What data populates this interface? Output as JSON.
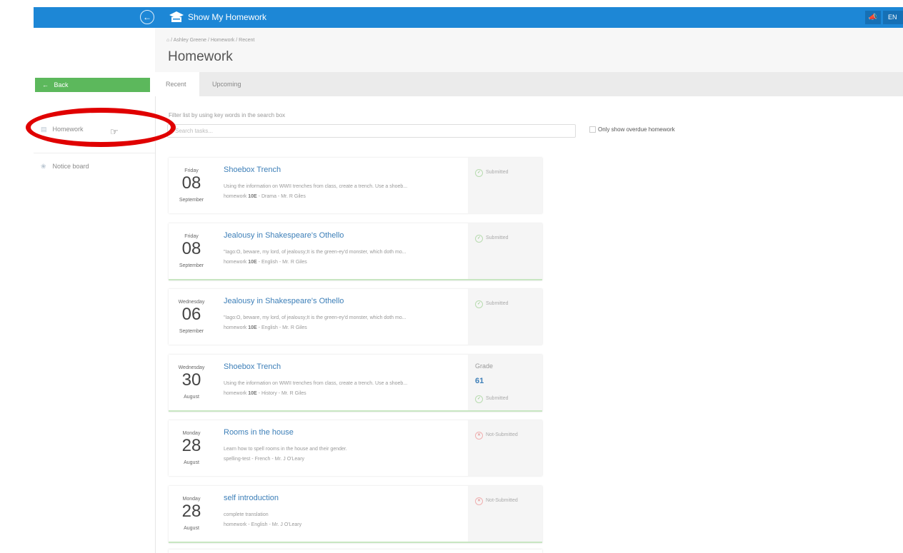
{
  "app": {
    "brand": "Show My Homework",
    "language": "EN"
  },
  "sidebar": {
    "back_label": "Back",
    "items": [
      {
        "label": "Homework",
        "icon": "list-icon"
      },
      {
        "label": "Notice board",
        "icon": "pin-icon"
      }
    ]
  },
  "header": {
    "breadcrumb": [
      "Ashley Greene",
      "Homework",
      "Recent"
    ],
    "title": "Homework"
  },
  "tabs": [
    {
      "label": "Recent",
      "active": true
    },
    {
      "label": "Upcoming",
      "active": false
    }
  ],
  "filter": {
    "help": "Filter list by using key words in the search box",
    "placeholder": "Search tasks...",
    "overdue_label": "Only show overdue homework"
  },
  "tasks": [
    {
      "dow": "Friday",
      "day": "08",
      "month": "September",
      "title": "Shoebox Trench",
      "desc": "Using the information on WWII trenches from class, create a trench. Use a shoeb...",
      "type": "homework",
      "class": "10E",
      "subject": "Drama",
      "teacher": "Mr. R Giles",
      "status": "Submitted"
    },
    {
      "dow": "Friday",
      "day": "08",
      "month": "September",
      "title": "Jealousy in Shakespeare's Othello",
      "desc": "\"Iago:O, beware, my lord, of jealousy;It is the green-ey'd monster, which doth mo...",
      "type": "homework",
      "class": "10E",
      "subject": "English",
      "teacher": "Mr. R Giles",
      "status": "Submitted"
    },
    {
      "dow": "Wednesday",
      "day": "06",
      "month": "September",
      "title": "Jealousy in Shakespeare's Othello",
      "desc": "\"Iago:O, beware, my lord, of jealousy;It is the green-ey'd monster, which doth mo...",
      "type": "homework",
      "class": "10E",
      "subject": "English",
      "teacher": "Mr. R Giles",
      "status": "Submitted"
    },
    {
      "dow": "Wednesday",
      "day": "30",
      "month": "August",
      "title": "Shoebox Trench",
      "desc": "Using the information on WWII trenches from class, create a trench. Use a shoeb...",
      "type": "homework",
      "class": "10E",
      "subject": "History",
      "teacher": "Mr. R Giles",
      "grade_label": "Grade",
      "grade": "61",
      "status": "Submitted"
    },
    {
      "dow": "Monday",
      "day": "28",
      "month": "August",
      "title": "Rooms in the house",
      "desc": "Learn how to spell rooms in the house and their gender.",
      "type": "spelling-test",
      "class": "",
      "subject": "French",
      "teacher": "Mr. J O'Leary",
      "status": "Not-Submitted"
    },
    {
      "dow": "Monday",
      "day": "28",
      "month": "August",
      "title": "self introduction",
      "desc": "complete translation",
      "type": "homework",
      "class": "",
      "subject": "English",
      "teacher": "Mr. J O'Leary",
      "status": "Not-Submitted"
    }
  ],
  "colors": {
    "topbar": "#1d87d6",
    "back_button": "#5cb85c",
    "link": "#3d7fb8",
    "annotation": "#e00000"
  }
}
